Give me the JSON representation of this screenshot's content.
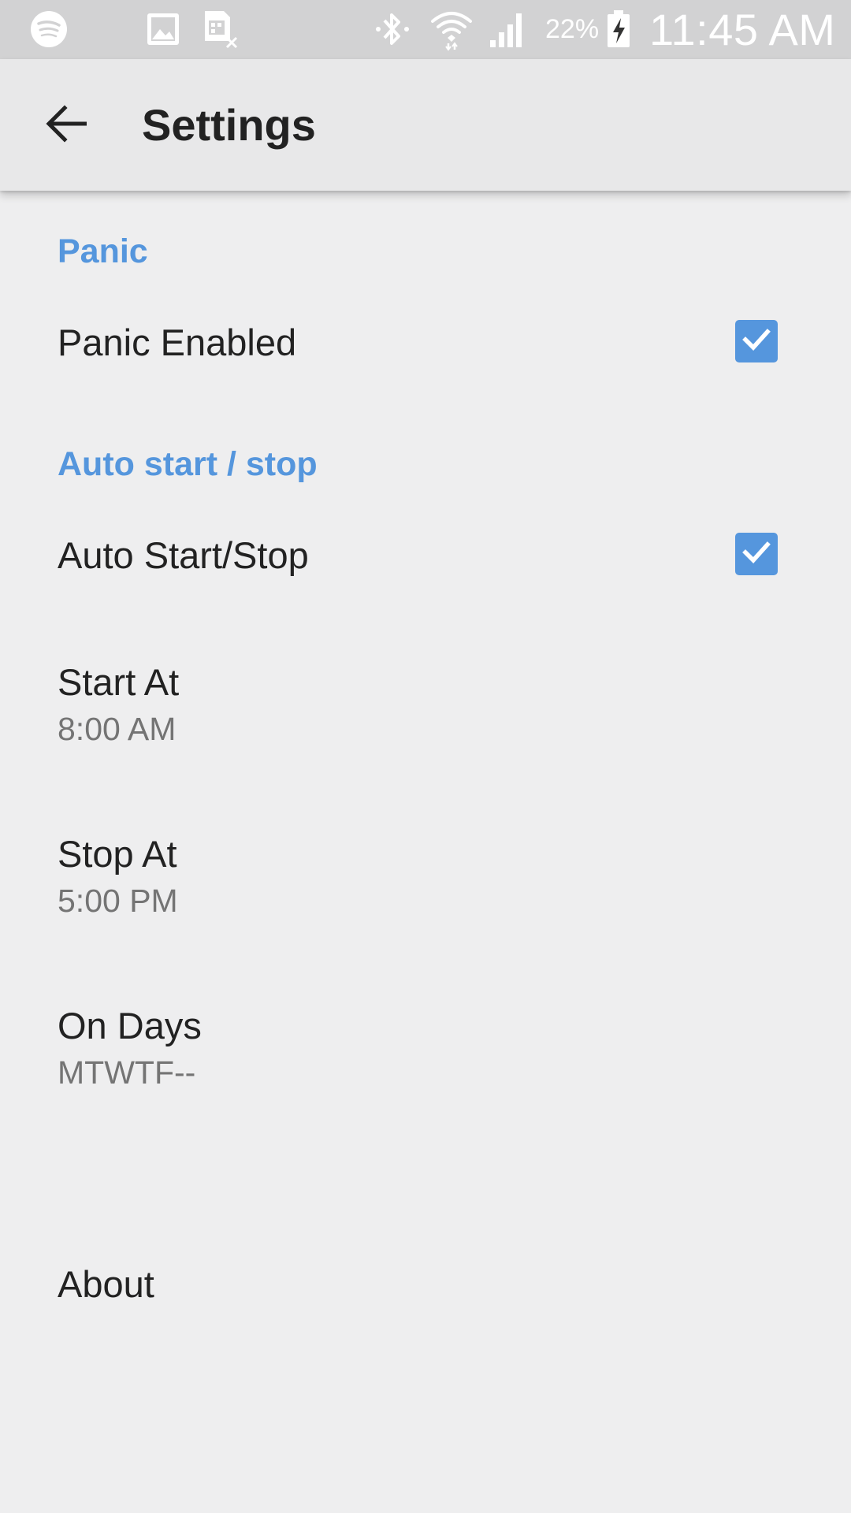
{
  "status_bar": {
    "icons": [
      "spotify-icon",
      "gallery-icon",
      "sim-card-icon",
      "bluetooth-icon",
      "wifi-icon",
      "signal-icon",
      "battery-charging-icon"
    ],
    "battery_percent": "22%",
    "time": "11:45 AM"
  },
  "app_bar": {
    "back_icon": "arrow-back-icon",
    "title": "Settings"
  },
  "sections": {
    "panic": {
      "header": "Panic",
      "panic_enabled": {
        "title": "Panic Enabled",
        "checked": true
      }
    },
    "auto": {
      "header": "Auto start / stop",
      "auto_start_stop": {
        "title": "Auto Start/Stop",
        "checked": true
      },
      "start_at": {
        "title": "Start At",
        "summary": "8:00 AM"
      },
      "stop_at": {
        "title": "Stop At",
        "summary": "5:00 PM"
      },
      "on_days": {
        "title": "On Days",
        "summary": "MTWTF--"
      }
    },
    "about": {
      "title": "About"
    }
  },
  "colors": {
    "accent": "#5596dd",
    "background": "#eeeeef",
    "app_bar": "#e8e8e9",
    "status_bar": "#d2d2d3",
    "text_primary": "#222222",
    "text_secondary": "#747474"
  }
}
